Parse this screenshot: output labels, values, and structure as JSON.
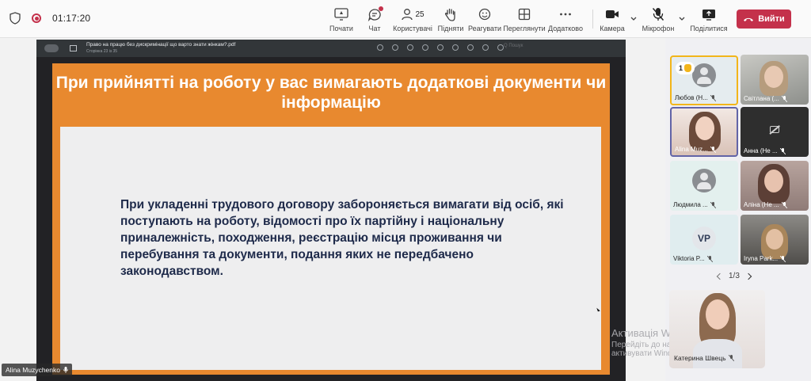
{
  "meeting": {
    "timer": "01:17:20",
    "participant_count": "25"
  },
  "toolbar": {
    "start_label": "Почати",
    "chat_label": "Чат",
    "people_label": "Користувачі",
    "raise_label": "Підняти",
    "react_label": "Реагувати",
    "view_label": "Переглянути",
    "more_label": "Додатково",
    "camera_label": "Камера",
    "mic_label": "Мікрофон",
    "share_label": "Поділитися",
    "leave_label": "Вийти",
    "leave_color": "#c4314b"
  },
  "pdf": {
    "filename": "Право на працю без дискримінації що варто знати жінкам?.pdf",
    "page_info": "Сторінка 23 із 35",
    "search_placeholder": "Q Пошук"
  },
  "slide": {
    "title": "При прийнятті на роботу у вас вимагають додаткові документи чи інформацію",
    "body": "При укладенні трудового договору забороняється вимагати від осіб, які поступають на роботу, відомості про їх партійну і національну приналежність, походження, реєстрацію місця проживання чи перебування та документи, подання яких не передбачено законодавством.",
    "accent_color": "#e8892f",
    "text_color": "#1e2a4a"
  },
  "presenter": {
    "name": "Alina Muzychenko"
  },
  "watermark": {
    "line1": "Активація Windows",
    "line2": "Перейдіть до настройки, щоб",
    "line3": "активувати Windows."
  },
  "participants": [
    {
      "name": "Любов (Н...",
      "raised_hand_count": "1"
    },
    {
      "name": "Світлана (..."
    },
    {
      "name": "Alina Muz..."
    },
    {
      "name": "Анна (Не ..."
    },
    {
      "name": "Людмила ..."
    },
    {
      "name": "Аліна (Не ..."
    },
    {
      "name": "Viktoria P...",
      "initials": "VP"
    },
    {
      "name": "Iryna Park..."
    }
  ],
  "pager": {
    "text": "1/3"
  },
  "self_view": {
    "name": "Катерина Швець"
  }
}
